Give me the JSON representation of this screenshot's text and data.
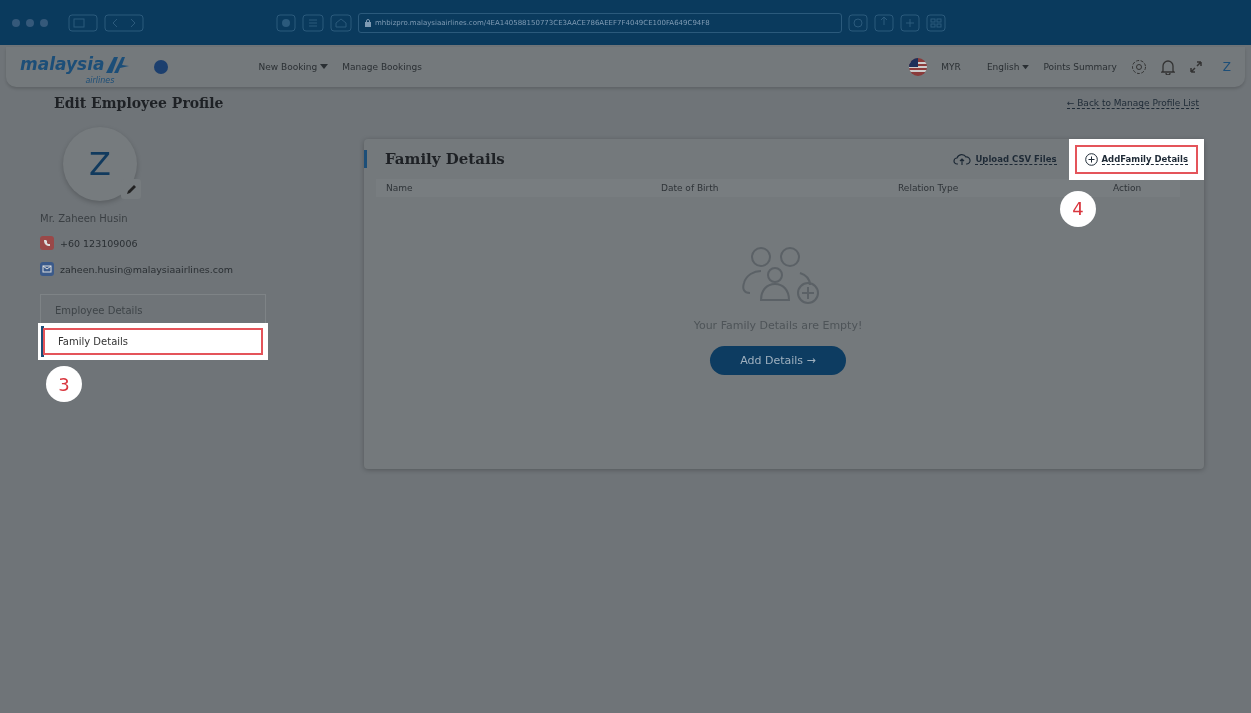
{
  "browser": {
    "url": "mhbizpro.malaysiaairlines.com/4EA140588150773CE3AACE786AEEF7F4049CE100FA649C94F8"
  },
  "header": {
    "logo": {
      "word": "malaysia",
      "sub": "airlines"
    },
    "nav": [
      {
        "label": "New Booking",
        "dropdown": true
      },
      {
        "label": "Manage Bookings",
        "dropdown": false
      }
    ],
    "currency": "MYR",
    "language": "English",
    "points": "Points Summary",
    "avatar": "Z"
  },
  "page": {
    "title": "Edit Employee Profile",
    "back_link": "← Back to Manage Profile List"
  },
  "profile": {
    "initial": "Z",
    "name": "Mr. Zaheen Husin",
    "phone": "+60 123109006",
    "email": "zaheen.husin@malaysiaairlines.com"
  },
  "side_menu": [
    {
      "label": "Employee Details",
      "selected": false,
      "highlighted": false
    },
    {
      "label": "Family Details",
      "selected": true,
      "highlighted": true
    }
  ],
  "step_markers": [
    "3",
    "4"
  ],
  "card": {
    "title": "Family Details",
    "actions": [
      {
        "kind": "upload",
        "label": "Upload CSV Files",
        "highlighted": false
      },
      {
        "kind": "add",
        "label": "AddFamily Details",
        "highlighted": true
      }
    ],
    "columns": [
      "Name",
      "Date of Birth",
      "Relation Type",
      "Action"
    ],
    "empty_message": "Your Family Details are Empty!",
    "button": "Add Details →"
  }
}
